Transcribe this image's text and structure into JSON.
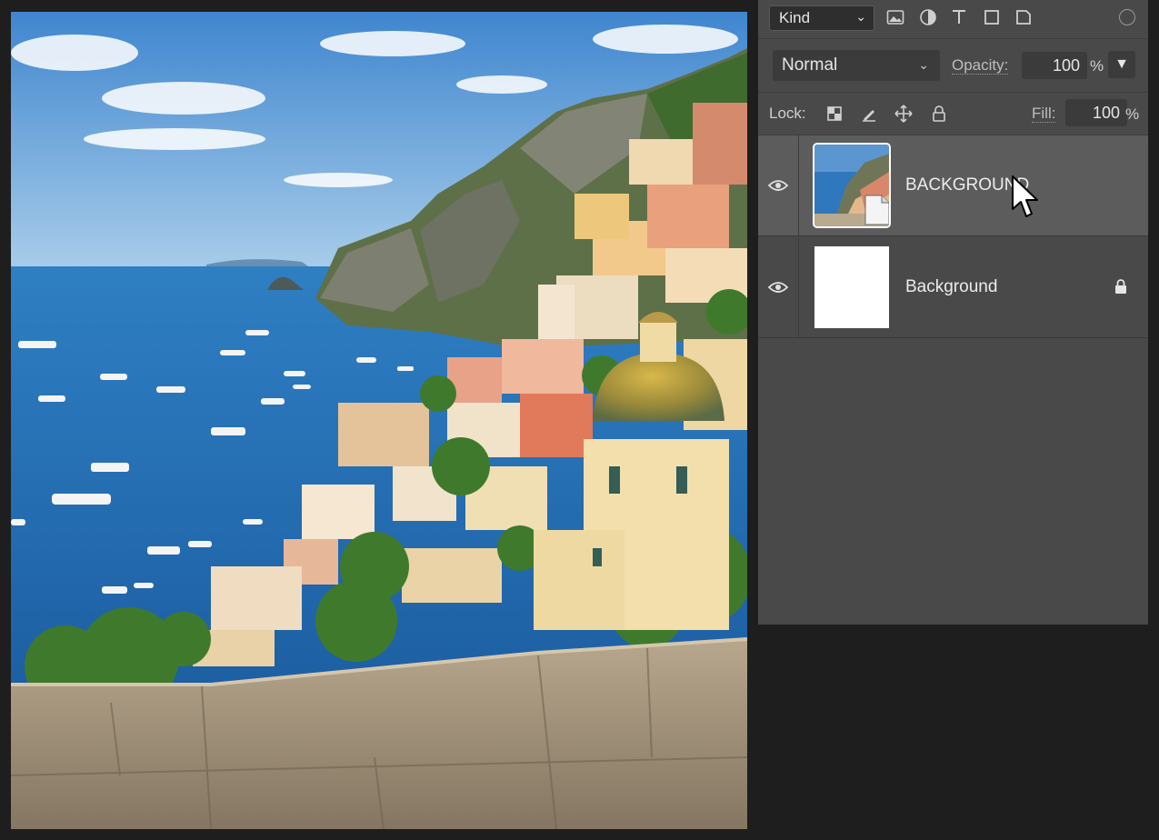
{
  "canvas": {
    "alt": "Coastal village photograph"
  },
  "layers_panel": {
    "filter": {
      "kind_label": "Kind",
      "icons": [
        "image-filter-icon",
        "adjustment-filter-icon",
        "type-filter-icon",
        "shape-filter-icon",
        "smart-object-filter-icon"
      ]
    },
    "blend_mode": "Normal",
    "opacity_label": "Opacity:",
    "opacity_value": "100",
    "opacity_unit": "%",
    "lock_label": "Lock:",
    "lock_icons": [
      "lock-transparent-pixels-icon",
      "lock-image-pixels-icon",
      "lock-position-icon",
      "lock-all-icon"
    ],
    "fill_label": "Fill:",
    "fill_value": "100",
    "fill_unit": "%",
    "layers": [
      {
        "name": "BACKGROUND",
        "selected": true,
        "visible": true,
        "type": "smart-object"
      },
      {
        "name": "Background",
        "selected": false,
        "visible": true,
        "locked": true
      }
    ]
  },
  "colors": {
    "panel_bg": "#494949",
    "selected_layer_bg": "#5c5c5c",
    "app_bg": "#1e1e1e"
  }
}
